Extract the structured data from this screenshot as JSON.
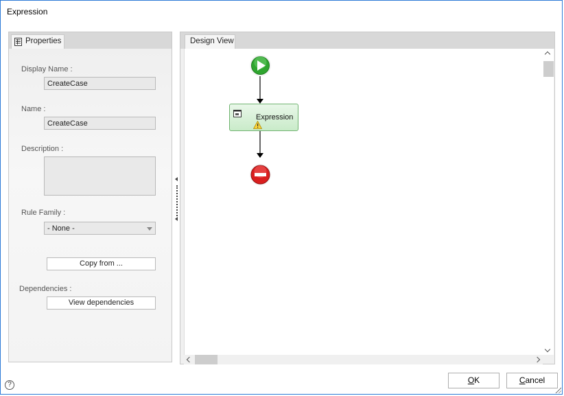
{
  "window": {
    "title": "Expression"
  },
  "properties": {
    "tab_label": "Properties",
    "display_name": {
      "label": "Display Name :",
      "value": "CreateCase"
    },
    "name": {
      "label": "Name :",
      "value": "CreateCase"
    },
    "description": {
      "label": "Description :",
      "value": ""
    },
    "rule_family": {
      "label": "Rule Family :",
      "selected": "- None -"
    },
    "copy_from_label": "Copy from ...",
    "dependencies": {
      "label": "Dependencies :",
      "button_label": "View dependencies"
    }
  },
  "design_view": {
    "tab_label": "Design View",
    "nodes": {
      "start": {
        "icon": "play-icon",
        "color": "#2fa52f"
      },
      "expression": {
        "label": "Expression",
        "icon": "document-icon",
        "warning_icon": "warning-icon"
      },
      "end": {
        "icon": "stop-icon",
        "color": "#d91f1f"
      }
    }
  },
  "footer": {
    "help": "?",
    "ok": {
      "mnemonic": "O",
      "rest": "K"
    },
    "cancel": {
      "mnemonic": "C",
      "rest": "ancel"
    }
  },
  "colors": {
    "accent_border": "#2b79d6"
  }
}
